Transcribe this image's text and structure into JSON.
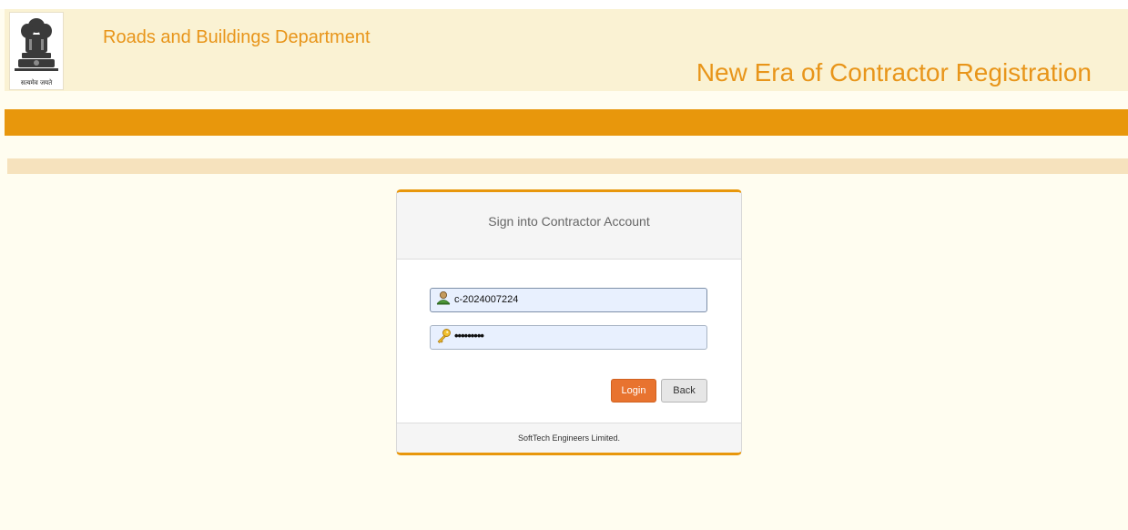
{
  "header": {
    "emblem_motto": "सत्यमेव जयते",
    "department": "Roads and Buildings Department",
    "app_title": "New Era of Contractor Registration"
  },
  "login": {
    "title": "Sign into Contractor Account",
    "username_value": "c-2024007224",
    "password_value": "•••••••••",
    "login_label": "Login",
    "back_label": "Back",
    "footer": "SoftTech Engineers Limited."
  },
  "icons": {
    "user": "user-icon",
    "password": "key-icon",
    "emblem": "national-emblem-logo"
  },
  "colors": {
    "accent": "#e8970c",
    "title_text": "#e8951a",
    "login_button": "#e8732f",
    "header_bg": "#faf2d3",
    "page_bg": "#fffdf0"
  }
}
